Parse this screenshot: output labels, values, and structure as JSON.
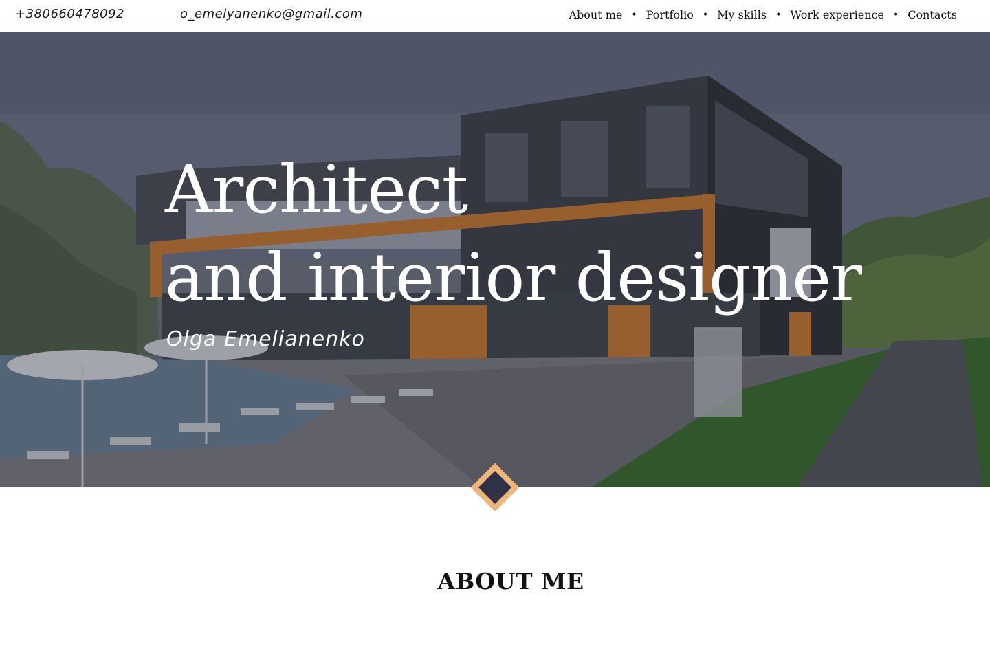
{
  "header": {
    "phone": "+380660478092",
    "email": "o_emelyanenko@gmail.com",
    "nav": [
      {
        "label": "About me"
      },
      {
        "label": "Portfolio"
      },
      {
        "label": "My skills"
      },
      {
        "label": "Work experience"
      },
      {
        "label": "Contacts"
      }
    ],
    "separator": "•"
  },
  "hero": {
    "title_line1": "Architect",
    "title_line2": "and interior designer",
    "subtitle": "Olga Emelianenko",
    "background": "architectural-building-render"
  },
  "marker": {
    "outer_color": "#f0b578",
    "inner_color": "#2f3247",
    "icon": "diamond-icon"
  },
  "about": {
    "heading": "ABOUT ME"
  }
}
